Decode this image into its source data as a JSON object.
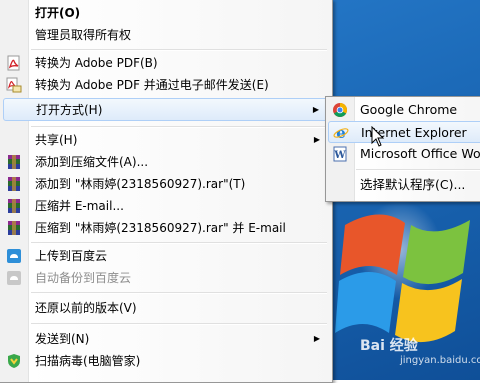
{
  "menu": {
    "open": "打开(O)",
    "admin": "管理员取得所有权",
    "to_pdf": "转换为 Adobe PDF(B)",
    "to_pdf_email": "转换为 Adobe PDF 并通过电子邮件发送(E)",
    "open_with": "打开方式(H)",
    "share": "共享(H)",
    "add_archive": "添加到压缩文件(A)...",
    "add_rar": "添加到 \"林雨婷(2318560927).rar\"(T)",
    "compress_email": "压缩并 E-mail...",
    "compress_rar_email": "压缩到 \"林雨婷(2318560927).rar\" 并 E-mail",
    "upload_baidu": "上传到百度云",
    "auto_backup": "自动备份到百度云",
    "restore": "还原以前的版本(V)",
    "send_to": "发送到(N)",
    "scan": "扫描病毒(电脑管家)"
  },
  "submenu": {
    "chrome": "Google Chrome",
    "ie": "Internet Explorer",
    "office": "Microsoft Office Word",
    "default": "选择默认程序(C)..."
  },
  "watermark": {
    "brand": "Bai 经验",
    "url": "jingyan.baidu.com"
  }
}
